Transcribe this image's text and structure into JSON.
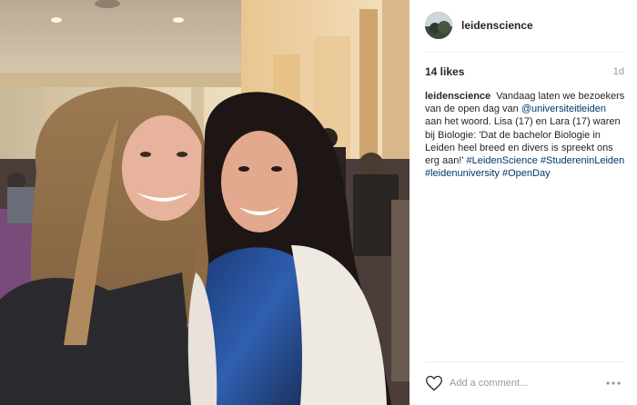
{
  "post": {
    "username": "leidenscience",
    "likes": "14 likes",
    "time_ago": "1d",
    "caption": {
      "author": "leidenscience",
      "text_1": "Vandaag laten we bezoekers van de open dag van",
      "mention": "@universiteitleiden",
      "text_2": "aan het woord. Lisa (17) en Lara (17) waren bij Biologie: 'Dat de bachelor Biologie in Leiden heel breed en divers is spreekt ons erg aan!'",
      "hashtags": [
        "#LeidenScience",
        "#StudereninLeiden",
        "#leidenuniversity",
        "#OpenDay"
      ]
    },
    "comment_placeholder": "Add a comment...",
    "icons": {
      "heart": "heart-outline-icon",
      "more": "more-options-icon"
    }
  }
}
